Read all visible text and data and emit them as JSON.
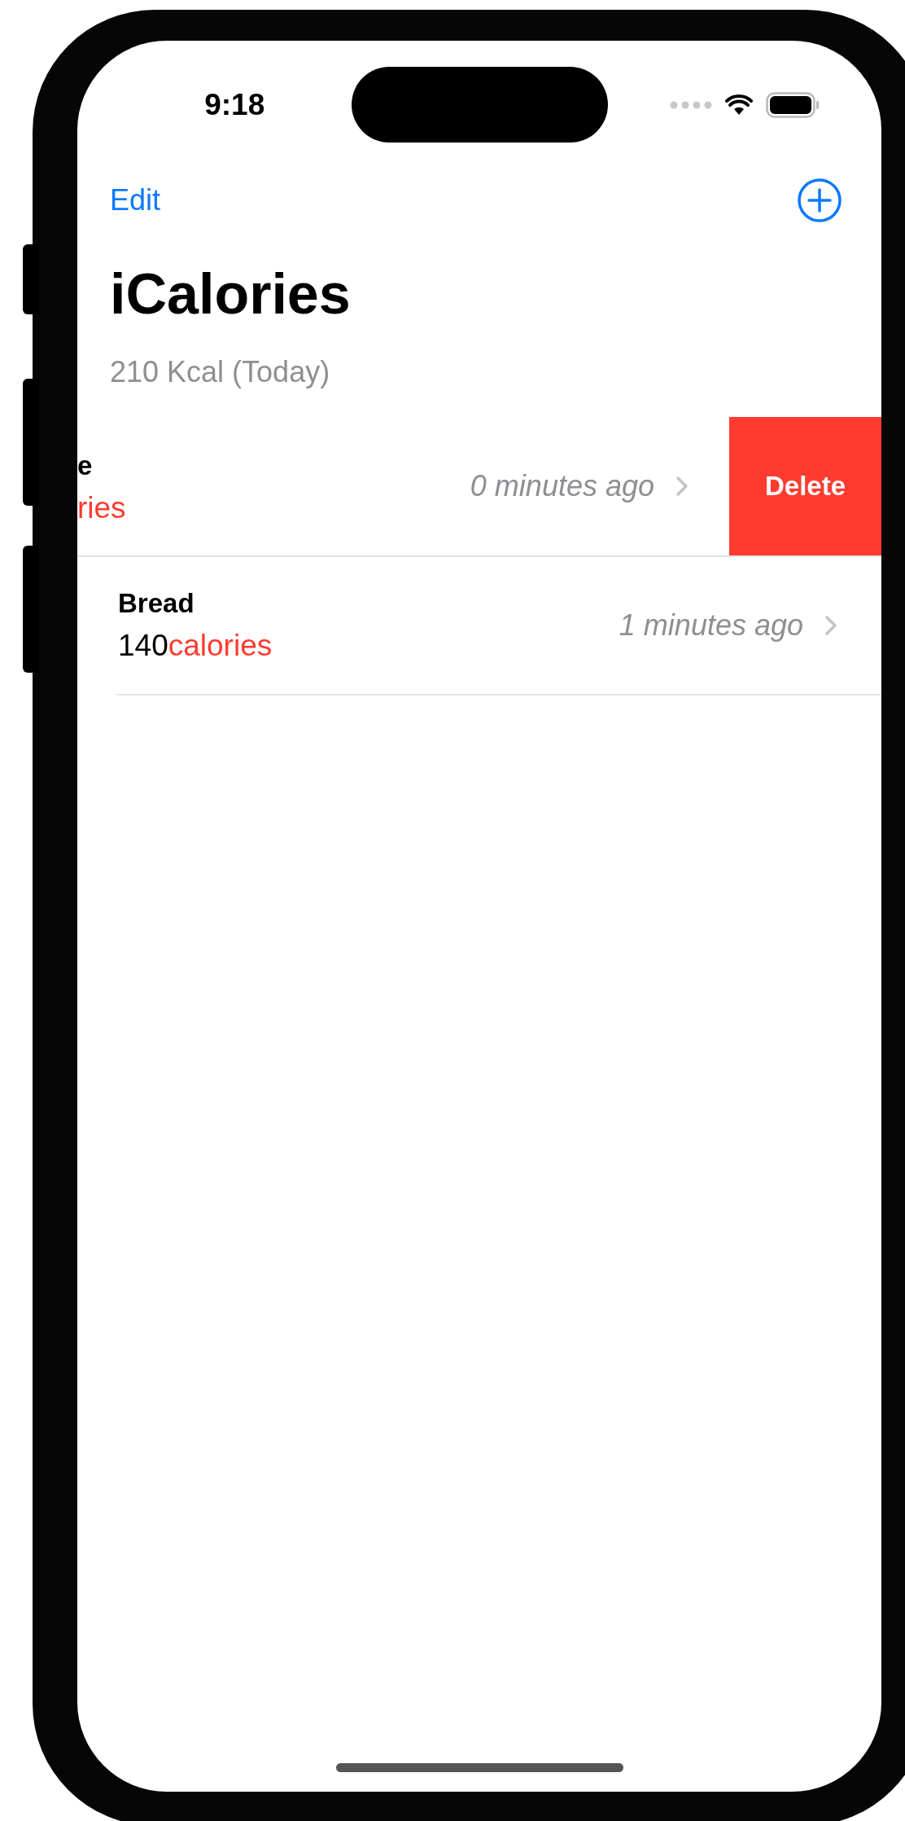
{
  "status_bar": {
    "time": "9:18"
  },
  "nav": {
    "edit": "Edit"
  },
  "title": "iCalories",
  "subtitle": "210 Kcal (Today)",
  "entries": [
    {
      "name": "e",
      "unit": "ries",
      "time": "0 minutes ago",
      "swiped": true,
      "action": "Delete"
    },
    {
      "name": "Bread",
      "amount": "140",
      "unit": "calories",
      "time": "1 minutes ago",
      "swiped": false
    }
  ]
}
